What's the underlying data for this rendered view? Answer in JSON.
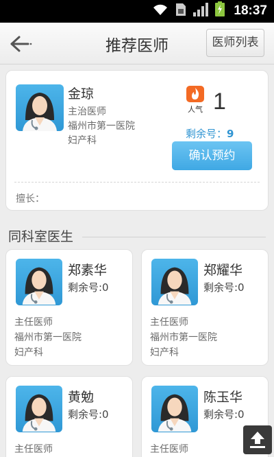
{
  "status_bar": {
    "time": "18:37"
  },
  "header": {
    "title": "推荐医师",
    "list_button": "医师列表"
  },
  "main_doctor": {
    "name": "金琼",
    "title": "主治医师",
    "hospital": "福州市第一医院",
    "department": "妇产科",
    "popularity_label": "人气",
    "popularity": "1",
    "remaining_label": "剩余号：",
    "remaining": "9",
    "confirm_button": "确认预约",
    "specialty_label": "擅长："
  },
  "section": {
    "title": "同科室医生"
  },
  "doctors": [
    {
      "name": "郑素华",
      "remaining": "剩余号:0",
      "title": "主任医师",
      "hospital": "福州市第一医院",
      "department": "妇产科"
    },
    {
      "name": "郑耀华",
      "remaining": "剩余号:0",
      "title": "主任医师",
      "hospital": "福州市第一医院",
      "department": "妇产科"
    },
    {
      "name": "黄勉",
      "remaining": "剩余号:0",
      "title": "主任医师"
    },
    {
      "name": "陈玉华",
      "remaining": "剩余号:0",
      "title": "主任医师"
    }
  ],
  "colors": {
    "accent": "#3fa8e4",
    "remaining_text": "#2f94d2",
    "popularity_icon": "#f36a24"
  }
}
